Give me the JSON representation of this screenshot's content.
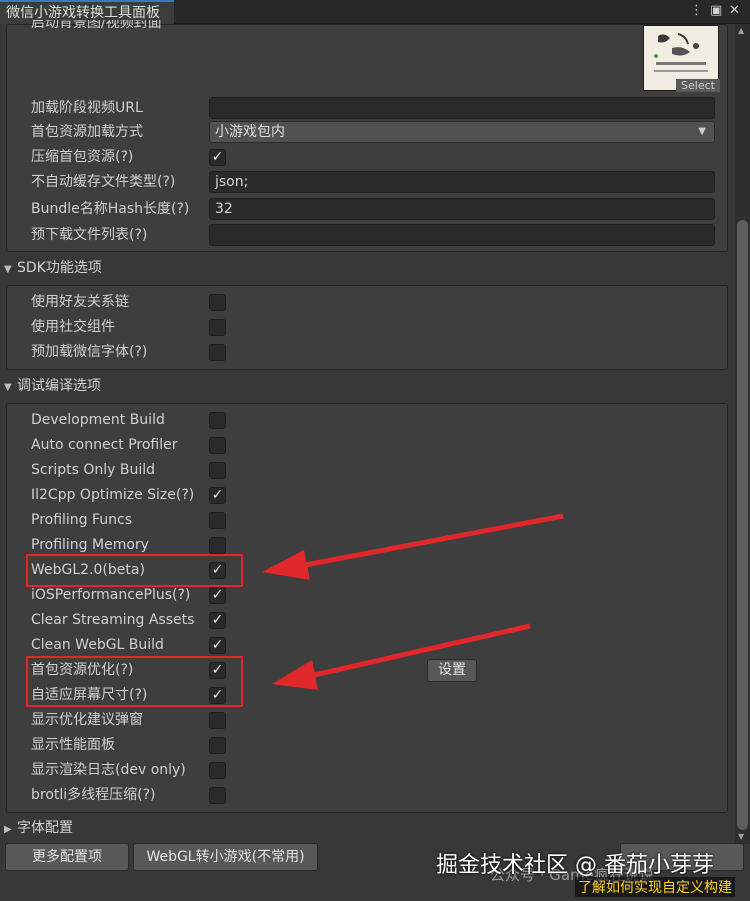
{
  "window": {
    "tab_title": "微信小游戏转换工具面板",
    "menu_icon": "kebab-menu-icon",
    "maximize_icon": "maximize-icon",
    "close_icon": "close-icon"
  },
  "top_partial_label": "启动背景图/视频封面",
  "thumbnail": {
    "select_label": "Select"
  },
  "load_settings": {
    "rows": [
      {
        "label": "加载阶段视频URL",
        "type": "text",
        "value": ""
      },
      {
        "label": "首包资源加载方式",
        "type": "dropdown",
        "value": "小游戏包内"
      },
      {
        "label": "压缩首包资源(?)",
        "type": "checkbox",
        "checked": true
      },
      {
        "label": "不自动缓存文件类型(?)",
        "type": "text",
        "value": "json;"
      },
      {
        "label": "Bundle名称Hash长度(?)",
        "type": "text",
        "value": "32"
      },
      {
        "label": "预下载文件列表(?)",
        "type": "text",
        "value": ""
      }
    ]
  },
  "sdk_section": {
    "title": "SDK功能选项",
    "rows": [
      {
        "label": "使用好友关系链",
        "checked": false
      },
      {
        "label": "使用社交组件",
        "checked": false
      },
      {
        "label": "预加载微信字体(?)",
        "checked": false
      }
    ]
  },
  "debug_section": {
    "title": "调试编译选项",
    "rows": [
      {
        "label": "Development Build",
        "checked": false
      },
      {
        "label": "Auto connect Profiler",
        "checked": false
      },
      {
        "label": "Scripts Only Build",
        "checked": false
      },
      {
        "label": "Il2Cpp Optimize Size(?)",
        "checked": true
      },
      {
        "label": "Profiling Funcs",
        "checked": false
      },
      {
        "label": "Profiling Memory",
        "checked": false
      },
      {
        "label": "WebGL2.0(beta)",
        "checked": true
      },
      {
        "label": "iOSPerformancePlus(?)",
        "checked": true
      },
      {
        "label": "Clear Streaming Assets",
        "checked": true
      },
      {
        "label": "Clean WebGL Build",
        "checked": true
      },
      {
        "label": "首包资源优化(?)",
        "checked": true
      },
      {
        "label": "自适应屏幕尺寸(?)",
        "checked": true
      },
      {
        "label": "显示优化建议弹窗",
        "checked": false
      },
      {
        "label": "显示性能面板",
        "checked": false
      },
      {
        "label": "显示渲染日志(dev only)",
        "checked": false
      },
      {
        "label": "brotli多线程压缩(?)",
        "checked": false
      }
    ],
    "settings_button": "设置"
  },
  "font_section": {
    "title": "字体配置"
  },
  "bottom_buttons": {
    "more_config": "更多配置项",
    "convert": "WebGL转小游戏(不常用)"
  },
  "overlay": {
    "watermark": "掘金技术社区 @ 番茄小芽芽",
    "watermark_small": "公众号 · Game疯狂说说",
    "note": "了解如何实现自定义构建"
  },
  "colors": {
    "annotation_red": "#e0282b",
    "note_yellow": "#ffd21f",
    "tab_accent": "#3a79bb"
  }
}
